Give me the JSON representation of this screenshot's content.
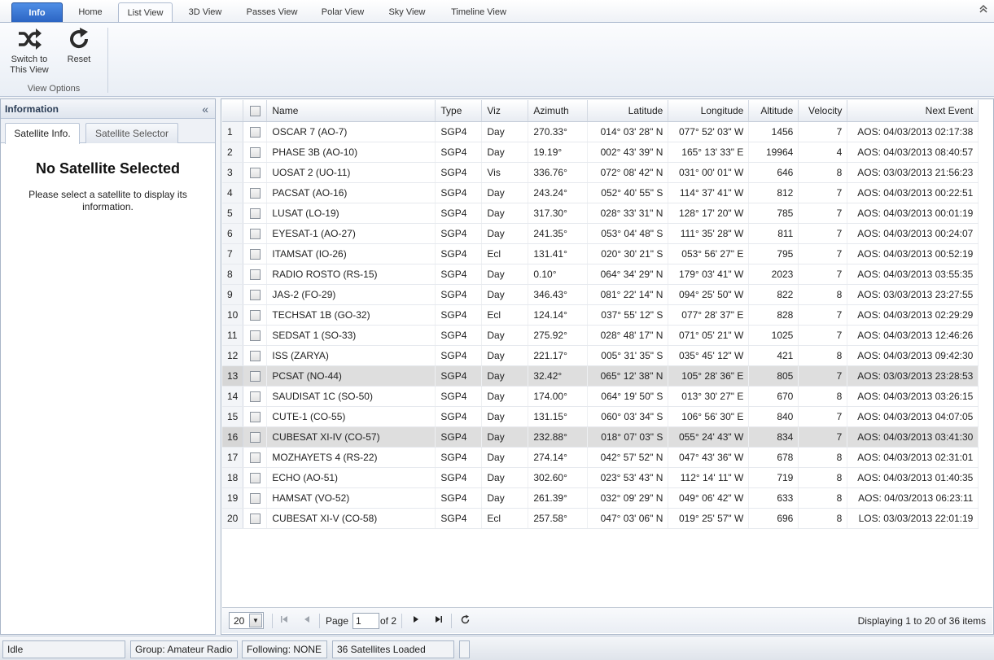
{
  "ribbon": {
    "tabs": [
      "Info",
      "Home",
      "List View",
      "3D View",
      "Passes View",
      "Polar View",
      "Sky View",
      "Timeline View"
    ],
    "active_tab": "List View",
    "buttons": {
      "switch_label": "Switch to This View",
      "reset_label": "Reset"
    },
    "group_label": "View Options"
  },
  "left_panel": {
    "title": "Information",
    "tabs": [
      "Satellite Info.",
      "Satellite Selector"
    ],
    "no_sat_title": "No Satellite Selected",
    "no_sat_message": "Please select a satellite to display its information."
  },
  "grid": {
    "columns": [
      "",
      "",
      "Name",
      "Type",
      "Viz",
      "Azimuth",
      "Latitude",
      "Longitude",
      "Altitude",
      "Velocity",
      "Next Event"
    ],
    "rows": [
      {
        "n": "1",
        "name": "OSCAR 7 (AO-7)",
        "type": "SGP4",
        "viz": "Day",
        "az": "270.33°",
        "lat": "014° 03' 28\" N",
        "lon": "077° 52' 03\" W",
        "alt": "1456",
        "vel": "7",
        "evt": "AOS: 04/03/2013 02:17:38",
        "sel": false
      },
      {
        "n": "2",
        "name": "PHASE 3B (AO-10)",
        "type": "SGP4",
        "viz": "Day",
        "az": "19.19°",
        "lat": "002° 43' 39\" N",
        "lon": "165° 13' 33\" E",
        "alt": "19964",
        "vel": "4",
        "evt": "AOS: 04/03/2013 08:40:57",
        "sel": false
      },
      {
        "n": "3",
        "name": "UOSAT 2 (UO-11)",
        "type": "SGP4",
        "viz": "Vis",
        "az": "336.76°",
        "lat": "072° 08' 42\" N",
        "lon": "031° 00' 01\" W",
        "alt": "646",
        "vel": "8",
        "evt": "AOS: 03/03/2013 21:56:23",
        "sel": false
      },
      {
        "n": "4",
        "name": "PACSAT (AO-16)",
        "type": "SGP4",
        "viz": "Day",
        "az": "243.24°",
        "lat": "052° 40' 55\" S",
        "lon": "114° 37' 41\" W",
        "alt": "812",
        "vel": "7",
        "evt": "AOS: 04/03/2013 00:22:51",
        "sel": false
      },
      {
        "n": "5",
        "name": "LUSAT (LO-19)",
        "type": "SGP4",
        "viz": "Day",
        "az": "317.30°",
        "lat": "028° 33' 31\" N",
        "lon": "128° 17' 20\" W",
        "alt": "785",
        "vel": "7",
        "evt": "AOS: 04/03/2013 00:01:19",
        "sel": false
      },
      {
        "n": "6",
        "name": "EYESAT-1 (AO-27)",
        "type": "SGP4",
        "viz": "Day",
        "az": "241.35°",
        "lat": "053° 04' 48\" S",
        "lon": "111° 35' 28\" W",
        "alt": "811",
        "vel": "7",
        "evt": "AOS: 04/03/2013 00:24:07",
        "sel": false
      },
      {
        "n": "7",
        "name": "ITAMSAT (IO-26)",
        "type": "SGP4",
        "viz": "Ecl",
        "az": "131.41°",
        "lat": "020° 30' 21\" S",
        "lon": "053° 56' 27\" E",
        "alt": "795",
        "vel": "7",
        "evt": "AOS: 04/03/2013 00:52:19",
        "sel": false
      },
      {
        "n": "8",
        "name": "RADIO ROSTO (RS-15)",
        "type": "SGP4",
        "viz": "Day",
        "az": "0.10°",
        "lat": "064° 34' 29\" N",
        "lon": "179° 03' 41\" W",
        "alt": "2023",
        "vel": "7",
        "evt": "AOS: 04/03/2013 03:55:35",
        "sel": false
      },
      {
        "n": "9",
        "name": "JAS-2 (FO-29)",
        "type": "SGP4",
        "viz": "Day",
        "az": "346.43°",
        "lat": "081° 22' 14\" N",
        "lon": "094° 25' 50\" W",
        "alt": "822",
        "vel": "8",
        "evt": "AOS: 03/03/2013 23:27:55",
        "sel": false
      },
      {
        "n": "10",
        "name": "TECHSAT 1B (GO-32)",
        "type": "SGP4",
        "viz": "Ecl",
        "az": "124.14°",
        "lat": "037° 55' 12\" S",
        "lon": "077° 28' 37\" E",
        "alt": "828",
        "vel": "7",
        "evt": "AOS: 04/03/2013 02:29:29",
        "sel": false
      },
      {
        "n": "11",
        "name": "SEDSAT 1 (SO-33)",
        "type": "SGP4",
        "viz": "Day",
        "az": "275.92°",
        "lat": "028° 48' 17\" N",
        "lon": "071° 05' 21\" W",
        "alt": "1025",
        "vel": "7",
        "evt": "AOS: 04/03/2013 12:46:26",
        "sel": false
      },
      {
        "n": "12",
        "name": "ISS (ZARYA)",
        "type": "SGP4",
        "viz": "Day",
        "az": "221.17°",
        "lat": "005° 31' 35\" S",
        "lon": "035° 45' 12\" W",
        "alt": "421",
        "vel": "8",
        "evt": "AOS: 04/03/2013 09:42:30",
        "sel": false
      },
      {
        "n": "13",
        "name": "PCSAT (NO-44)",
        "type": "SGP4",
        "viz": "Day",
        "az": "32.42°",
        "lat": "065° 12' 38\" N",
        "lon": "105° 28' 36\" E",
        "alt": "805",
        "vel": "7",
        "evt": "AOS: 03/03/2013 23:28:53",
        "sel": true
      },
      {
        "n": "14",
        "name": "SAUDISAT 1C (SO-50)",
        "type": "SGP4",
        "viz": "Day",
        "az": "174.00°",
        "lat": "064° 19' 50\" S",
        "lon": "013° 30' 27\" E",
        "alt": "670",
        "vel": "8",
        "evt": "AOS: 04/03/2013 03:26:15",
        "sel": false
      },
      {
        "n": "15",
        "name": "CUTE-1 (CO-55)",
        "type": "SGP4",
        "viz": "Day",
        "az": "131.15°",
        "lat": "060° 03' 34\" S",
        "lon": "106° 56' 30\" E",
        "alt": "840",
        "vel": "7",
        "evt": "AOS: 04/03/2013 04:07:05",
        "sel": false
      },
      {
        "n": "16",
        "name": "CUBESAT XI-IV (CO-57)",
        "type": "SGP4",
        "viz": "Day",
        "az": "232.88°",
        "lat": "018° 07' 03\" S",
        "lon": "055° 24' 43\" W",
        "alt": "834",
        "vel": "7",
        "evt": "AOS: 04/03/2013 03:41:30",
        "sel": true
      },
      {
        "n": "17",
        "name": "MOZHAYETS 4 (RS-22)",
        "type": "SGP4",
        "viz": "Day",
        "az": "274.14°",
        "lat": "042° 57' 52\" N",
        "lon": "047° 43' 36\" W",
        "alt": "678",
        "vel": "8",
        "evt": "AOS: 04/03/2013 02:31:01",
        "sel": false
      },
      {
        "n": "18",
        "name": "ECHO (AO-51)",
        "type": "SGP4",
        "viz": "Day",
        "az": "302.60°",
        "lat": "023° 53' 43\" N",
        "lon": "112° 14' 11\" W",
        "alt": "719",
        "vel": "8",
        "evt": "AOS: 04/03/2013 01:40:35",
        "sel": false
      },
      {
        "n": "19",
        "name": "HAMSAT (VO-52)",
        "type": "SGP4",
        "viz": "Day",
        "az": "261.39°",
        "lat": "032° 09' 29\" N",
        "lon": "049° 06' 42\" W",
        "alt": "633",
        "vel": "8",
        "evt": "AOS: 04/03/2013 06:23:11",
        "sel": false
      },
      {
        "n": "20",
        "name": "CUBESAT XI-V (CO-58)",
        "type": "SGP4",
        "viz": "Ecl",
        "az": "257.58°",
        "lat": "047° 03' 06\" N",
        "lon": "019° 25' 57\" W",
        "alt": "696",
        "vel": "8",
        "evt": "LOS: 03/03/2013 22:01:19",
        "sel": false
      }
    ]
  },
  "pager": {
    "page_size": "20",
    "page_label": "Page",
    "current_page": "1",
    "of_label": "of 2",
    "summary": "Displaying 1 to 20 of 36 items"
  },
  "status": {
    "state": "Idle",
    "group": "Group: Amateur Radio",
    "following": "Following: NONE",
    "loaded": "36 Satellites Loaded"
  },
  "icons": {
    "switch": "shuffle-icon",
    "reset": "refresh-icon"
  }
}
